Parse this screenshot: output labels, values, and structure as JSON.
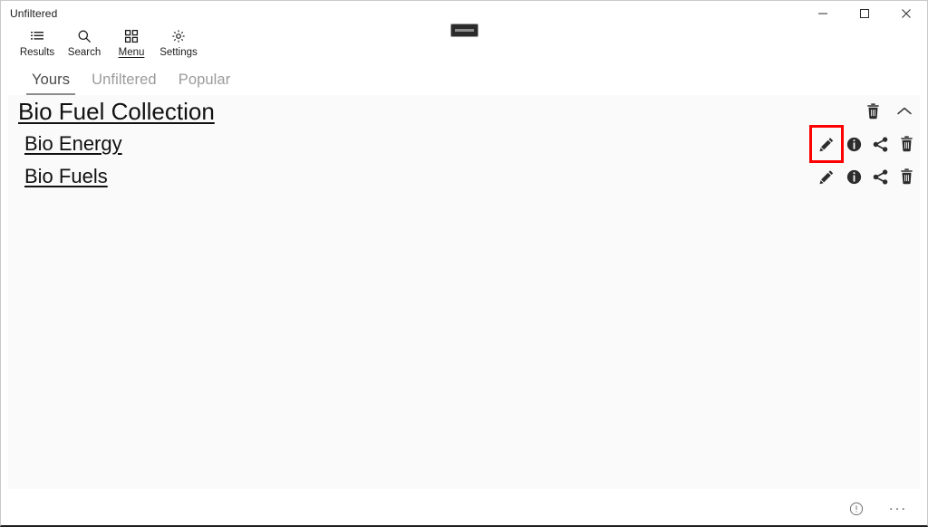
{
  "window": {
    "title": "Unfiltered",
    "controls": {
      "minimize": "minimize",
      "maximize": "maximize",
      "close": "close"
    },
    "drag_chip": "window-drag-handle"
  },
  "commandbar": {
    "items": [
      {
        "label": "Results",
        "icon": "list-icon",
        "active": false
      },
      {
        "label": "Search",
        "icon": "search-icon",
        "active": false
      },
      {
        "label": "Menu",
        "icon": "grid-icon",
        "active": true
      },
      {
        "label": "Settings",
        "icon": "gear-icon",
        "active": false
      }
    ]
  },
  "tabs": {
    "items": [
      {
        "label": "Yours",
        "active": true
      },
      {
        "label": "Unfiltered",
        "active": false
      },
      {
        "label": "Popular",
        "active": false
      }
    ]
  },
  "collection": {
    "title": "Bio Fuel Collection",
    "actions": [
      {
        "name": "delete-collection",
        "icon": "trash-icon"
      },
      {
        "name": "collapse-collection",
        "icon": "chevron-up-icon"
      }
    ],
    "items": [
      {
        "title": "Bio Energy",
        "actions": [
          {
            "name": "edit",
            "icon": "pencil-icon",
            "highlighted": true
          },
          {
            "name": "info",
            "icon": "info-icon",
            "highlighted": false
          },
          {
            "name": "share",
            "icon": "share-icon",
            "highlighted": false
          },
          {
            "name": "delete",
            "icon": "trash-icon",
            "highlighted": false
          }
        ]
      },
      {
        "title": "Bio Fuels",
        "actions": [
          {
            "name": "edit",
            "icon": "pencil-icon",
            "highlighted": false
          },
          {
            "name": "info",
            "icon": "info-icon",
            "highlighted": false
          },
          {
            "name": "share",
            "icon": "share-icon",
            "highlighted": false
          },
          {
            "name": "delete",
            "icon": "trash-icon",
            "highlighted": false
          }
        ]
      }
    ]
  },
  "statusbar": {
    "info_label": "info-circle-icon",
    "more_label": "..."
  },
  "colors": {
    "highlight": "#ff0000",
    "content_bg": "#fafafa",
    "text": "#111111",
    "muted": "#9b9b9b"
  }
}
